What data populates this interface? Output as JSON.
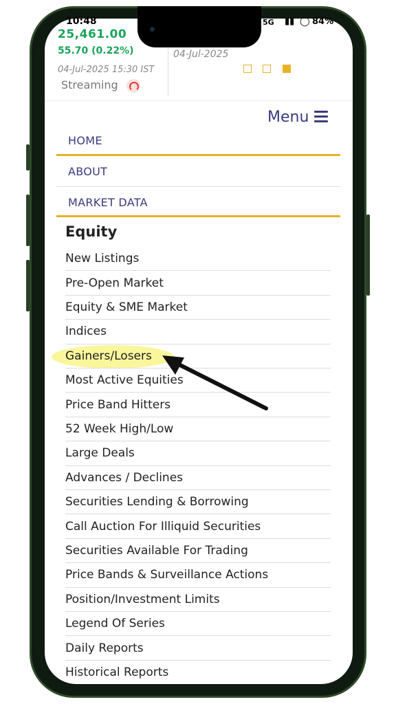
{
  "status_bar": {
    "time": "10:48",
    "network": "5G",
    "battery": "84%"
  },
  "ticker": {
    "index_value": "25,461.00",
    "change": "55.70  (0.22%)",
    "timestamp": "04-Jul-2025 15:30 IST",
    "streaming_label": "Streaming",
    "second_date": "04-Jul-2025",
    "accent_color": "#e6b325",
    "positive_color": "#1aa35a"
  },
  "menu": {
    "label": "Menu",
    "items": [
      {
        "label": "HOME"
      },
      {
        "label": "ABOUT"
      },
      {
        "label": "MARKET DATA"
      }
    ]
  },
  "equity": {
    "title": "Equity",
    "items": [
      {
        "label": "New Listings"
      },
      {
        "label": "Pre-Open Market"
      },
      {
        "label": "Equity & SME Market"
      },
      {
        "label": "Indices"
      },
      {
        "label": "Gainers/Losers"
      },
      {
        "label": "Most Active Equities"
      },
      {
        "label": "Price Band Hitters"
      },
      {
        "label": "52 Week High/Low"
      },
      {
        "label": "Large Deals"
      },
      {
        "label": "Advances / Declines"
      },
      {
        "label": "Securities Lending & Borrowing"
      },
      {
        "label": "Call Auction For Illiquid Securities"
      },
      {
        "label": "Securities Available For Trading"
      },
      {
        "label": "Price Bands & Surveillance Actions"
      },
      {
        "label": "Position/Investment Limits"
      },
      {
        "label": "Legend Of Series"
      },
      {
        "label": "Daily Reports"
      },
      {
        "label": "Historical Reports"
      }
    ]
  }
}
